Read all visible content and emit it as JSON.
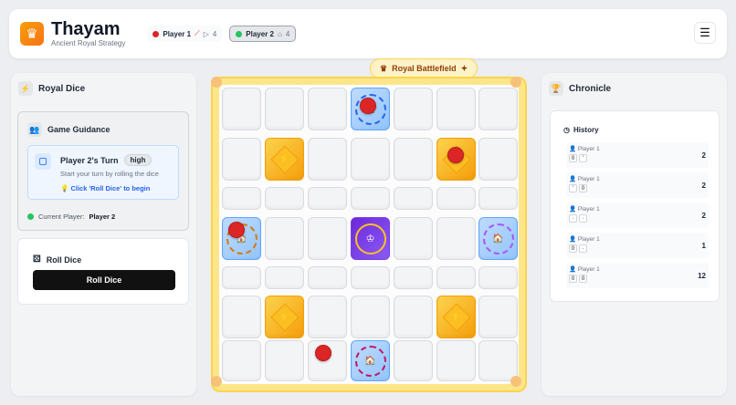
{
  "header": {
    "title": "Thayam",
    "subtitle": "Ancient Royal Strategy",
    "players": [
      {
        "label": "Player 1",
        "stat": "4",
        "color": "#dc2626"
      },
      {
        "label": "Player 2",
        "stat": "4",
        "color": "#22c55e"
      }
    ]
  },
  "left_panel": {
    "title": "Royal Dice",
    "guidance": {
      "title": "Game Guidance",
      "turn_title": "Player 2's Turn",
      "priority": "high",
      "description": "Start your turn by rolling the dice",
      "cta": "Click 'Roll Dice' to begin",
      "current_label": "Current Player:",
      "current_value": "Player 2"
    },
    "roll": {
      "title": "Roll Dice",
      "button": "Roll Dice"
    }
  },
  "board": {
    "label": "Royal Battlefield"
  },
  "right_panel": {
    "title": "Chronicle",
    "history_title": "History",
    "entries": [
      {
        "player": "Player 1",
        "dice": [
          "0",
          "'"
        ],
        "score": "2"
      },
      {
        "player": "Player 1",
        "dice": [
          "'",
          "0"
        ],
        "score": "2"
      },
      {
        "player": "Player 1",
        "dice": [
          "·",
          "·"
        ],
        "score": "2"
      },
      {
        "player": "Player 1",
        "dice": [
          "0",
          "·"
        ],
        "score": "1"
      },
      {
        "player": "Player 1",
        "dice": [
          "0",
          "0"
        ],
        "score": "12"
      }
    ]
  },
  "colors": {
    "accent": "#f59e0b",
    "player1": "#dc2626",
    "player2": "#22c55e",
    "safe": "#93c5fd",
    "center": "#7c3aed"
  }
}
